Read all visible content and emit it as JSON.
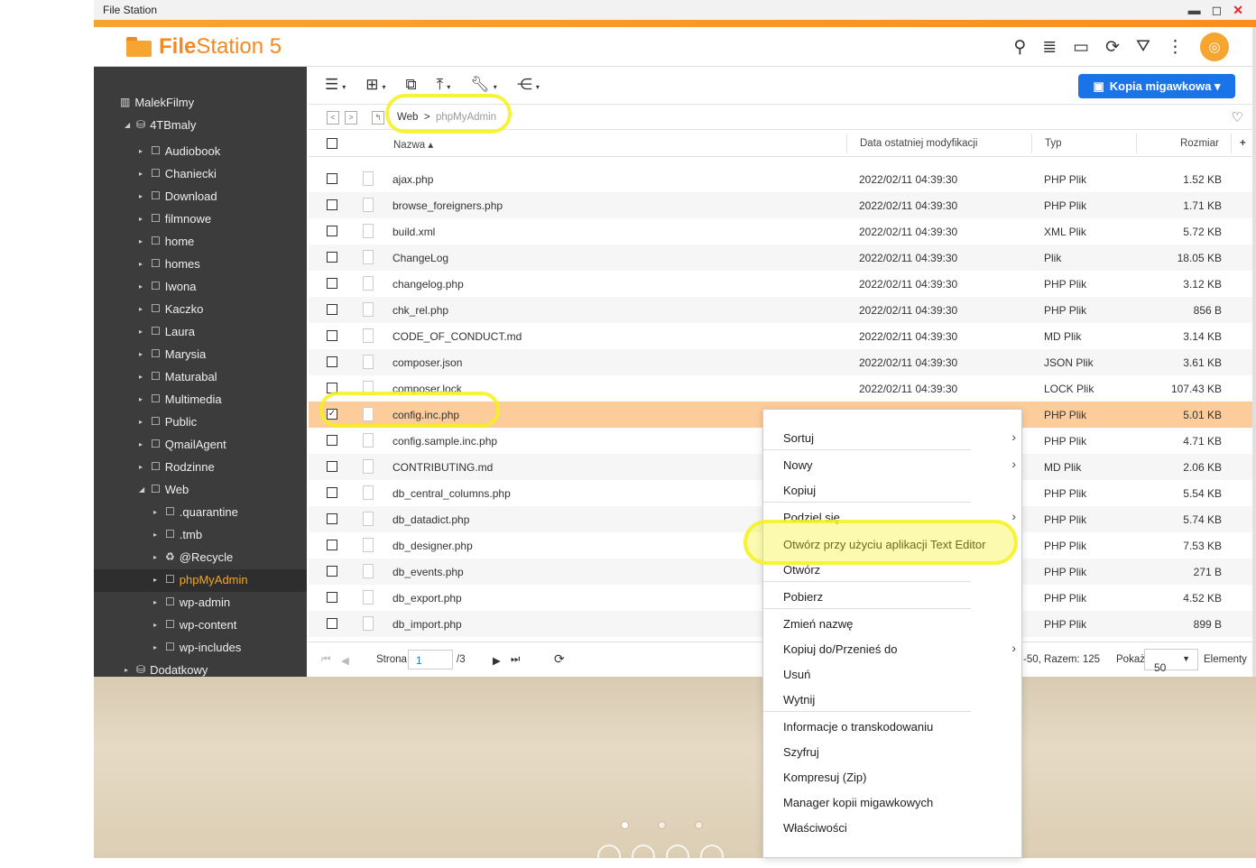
{
  "window": {
    "title": "File Station",
    "app_name_bold": "File",
    "app_name_rest": "Station 5"
  },
  "header_icons": [
    "search-icon",
    "stack-icon",
    "cast-icon",
    "refresh-icon",
    "filter-icon",
    "more-icon",
    "user-icon"
  ],
  "accent_color": "#f5881f",
  "sidebar": {
    "root": "MalekFilmy",
    "volume": "4TBmaly",
    "folders": [
      "Audiobook",
      "Chaniecki",
      "Download",
      "filmnowe",
      "home",
      "homes",
      "Iwona",
      "Kaczko",
      "Laura",
      "Marysia",
      "Maturabal",
      "Multimedia",
      "Public",
      "QmailAgent",
      "Rodzinne",
      "Web"
    ],
    "web_children": [
      ".quarantine",
      ".tmb",
      "@Recycle",
      "phpMyAdmin",
      "wp-admin",
      "wp-content",
      "wp-includes"
    ],
    "extra_volume": "Dodatkowy",
    "selected": "phpMyAdmin"
  },
  "toolbar": {
    "snapshot_label": "Kopia migawkowa ▾"
  },
  "path": {
    "parent": "Web",
    "sep": ">",
    "current": "phpMyAdmin"
  },
  "columns": {
    "name": "Nazwa ▴",
    "modified": "Data ostatniej modyfikacji",
    "type": "Typ",
    "size": "Rozmiar",
    "add": "+"
  },
  "files": [
    {
      "name": "ajax.php",
      "date": "2022/02/11 04:39:30",
      "type": "PHP Plik",
      "size": "1.52 KB",
      "checked": false
    },
    {
      "name": "browse_foreigners.php",
      "date": "2022/02/11 04:39:30",
      "type": "PHP Plik",
      "size": "1.71 KB",
      "checked": false
    },
    {
      "name": "build.xml",
      "date": "2022/02/11 04:39:30",
      "type": "XML Plik",
      "size": "5.72 KB",
      "checked": false
    },
    {
      "name": "ChangeLog",
      "date": "2022/02/11 04:39:30",
      "type": "Plik",
      "size": "18.05 KB",
      "checked": false
    },
    {
      "name": "changelog.php",
      "date": "2022/02/11 04:39:30",
      "type": "PHP Plik",
      "size": "3.12 KB",
      "checked": false
    },
    {
      "name": "chk_rel.php",
      "date": "2022/02/11 04:39:30",
      "type": "PHP Plik",
      "size": "856 B",
      "checked": false
    },
    {
      "name": "CODE_OF_CONDUCT.md",
      "date": "2022/02/11 04:39:30",
      "type": "MD Plik",
      "size": "3.14 KB",
      "checked": false
    },
    {
      "name": "composer.json",
      "date": "2022/02/11 04:39:30",
      "type": "JSON Plik",
      "size": "3.61 KB",
      "checked": false
    },
    {
      "name": "composer.lock",
      "date": "2022/02/11 04:39:30",
      "type": "LOCK Plik",
      "size": "107.43 KB",
      "checked": false
    },
    {
      "name": "config.inc.php",
      "date": "",
      "type": "PHP Plik",
      "size": "5.01 KB",
      "checked": true
    },
    {
      "name": "config.sample.inc.php",
      "date": "",
      "type": "PHP Plik",
      "size": "4.71 KB",
      "checked": false
    },
    {
      "name": "CONTRIBUTING.md",
      "date": "",
      "type": "MD Plik",
      "size": "2.06 KB",
      "checked": false
    },
    {
      "name": "db_central_columns.php",
      "date": "",
      "type": "PHP Plik",
      "size": "5.54 KB",
      "checked": false
    },
    {
      "name": "db_datadict.php",
      "date": "",
      "type": "PHP Plik",
      "size": "5.74 KB",
      "checked": false
    },
    {
      "name": "db_designer.php",
      "date": "",
      "type": "PHP Plik",
      "size": "7.53 KB",
      "checked": false
    },
    {
      "name": "db_events.php",
      "date": "",
      "type": "PHP Plik",
      "size": "271 B",
      "checked": false
    },
    {
      "name": "db_export.php",
      "date": "",
      "type": "PHP Plik",
      "size": "4.52 KB",
      "checked": false
    },
    {
      "name": "db_import.php",
      "date": "",
      "type": "PHP Plik",
      "size": "899 B",
      "checked": false
    }
  ],
  "pager": {
    "page_label": "Strona",
    "page_value": "1",
    "total_pages": "/3",
    "range_text": "-50, Razem: 125",
    "show_label": "Pokaż",
    "show_value": "50",
    "items_label": "Elementy"
  },
  "context_menu": [
    {
      "label": "Sortuj",
      "submenu": true,
      "sep_after": true
    },
    {
      "label": "Nowy",
      "submenu": true,
      "sep_after": false
    },
    {
      "label": "Kopiuj",
      "submenu": false,
      "sep_after": true
    },
    {
      "label": "Podziel się",
      "submenu": true,
      "sep_after": false
    },
    {
      "label": "Otwórz przy użyciu aplikacji Text Editor",
      "submenu": false,
      "sep_after": false
    },
    {
      "label": "Otwórz",
      "submenu": false,
      "sep_after": true
    },
    {
      "label": "Pobierz",
      "submenu": false,
      "sep_after": true
    },
    {
      "label": "Zmień nazwę",
      "submenu": false,
      "sep_after": false
    },
    {
      "label": "Kopiuj do/Przenieś do",
      "submenu": true,
      "sep_after": false
    },
    {
      "label": "Usuń",
      "submenu": false,
      "sep_after": false
    },
    {
      "label": "Wytnij",
      "submenu": false,
      "sep_after": true
    },
    {
      "label": "Informacje o transkodowaniu",
      "submenu": false,
      "sep_after": false
    },
    {
      "label": "Szyfruj",
      "submenu": false,
      "sep_after": false
    },
    {
      "label": "Kompresuj (Zip)",
      "submenu": false,
      "sep_after": false
    },
    {
      "label": "Manager kopii migawkowych",
      "submenu": false,
      "sep_after": false
    },
    {
      "label": "Właściwości",
      "submenu": false,
      "sep_after": false
    }
  ]
}
